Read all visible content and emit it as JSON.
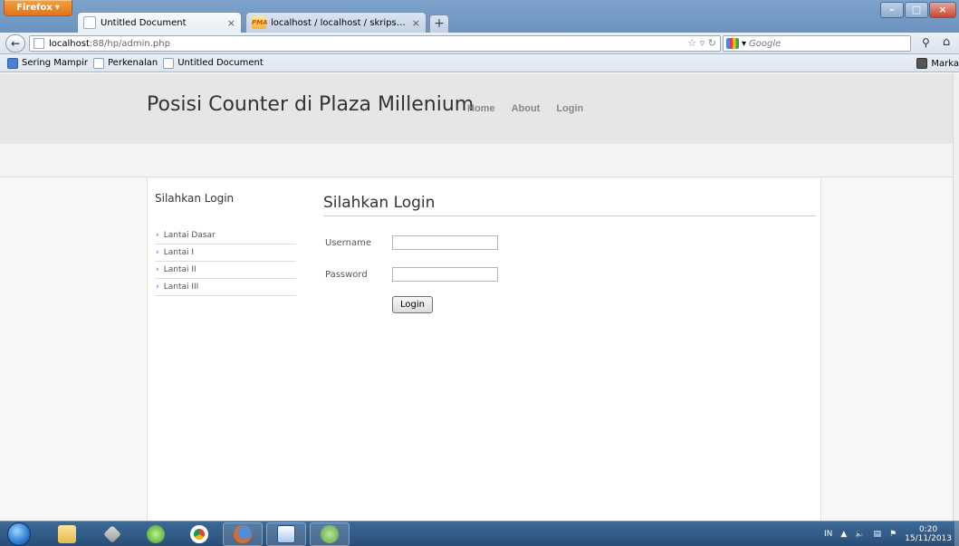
{
  "browser": {
    "app_button": "Firefox",
    "tabs": [
      {
        "title": "Untitled Document",
        "active": true
      },
      {
        "title": "localhost / localhost / skripsi_counter...",
        "active": false
      }
    ],
    "url": {
      "host": "localhost",
      "path": ":88/hp/admin.php"
    },
    "search_placeholder": "Google",
    "bookmarks": [
      "Sering Mampir",
      "Perkenalan",
      "Untitled Document"
    ],
    "bookmarks_right": "Marka",
    "favicon_pma": "PMA"
  },
  "site": {
    "title": "Posisi Counter di Plaza Millenium",
    "menu": [
      "Home",
      "About",
      "Login"
    ]
  },
  "sidebar": {
    "title": "Silahkan Login",
    "items": [
      "Lantai Dasar",
      "Lantai I",
      "Lantai II",
      "Lantai III"
    ]
  },
  "login_form": {
    "title": "Silahkan Login",
    "username_label": "Username",
    "username_value": "",
    "password_label": "Password",
    "password_value": "",
    "submit_label": "Login"
  },
  "taskbar": {
    "language": "IN",
    "time": "0:20",
    "date": "15/11/2013"
  }
}
